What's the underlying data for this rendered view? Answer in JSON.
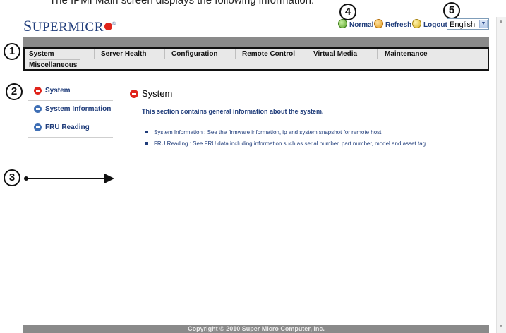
{
  "caption": "The IPMI Main screen displays the following information:",
  "logo": {
    "text_big": "S",
    "text_rest": "UPERMICR",
    "tm": "®"
  },
  "status": {
    "label": "Normal",
    "refresh": "Refresh",
    "logout": "Logout"
  },
  "language": {
    "selected": "English"
  },
  "menu": {
    "items": [
      "System",
      "Server Health",
      "Configuration",
      "Remote Control",
      "Virtual Media",
      "Maintenance",
      "Miscellaneous"
    ]
  },
  "callouts": [
    "1",
    "2",
    "3",
    "4",
    "5"
  ],
  "nav": {
    "items": [
      {
        "label": "System",
        "active": true
      },
      {
        "label": "System Information",
        "active": false
      },
      {
        "label": "FRU Reading",
        "active": false
      }
    ]
  },
  "main": {
    "title": "System",
    "intro": "This section contains general information about the system.",
    "bullets": [
      "System Information : See the firmware information, ip and system snapshot for remote host.",
      "FRU Reading : See FRU data including information such as serial number, part number, model and asset tag."
    ]
  },
  "footer": "Copyright © 2010 Super Micro Computer, Inc."
}
